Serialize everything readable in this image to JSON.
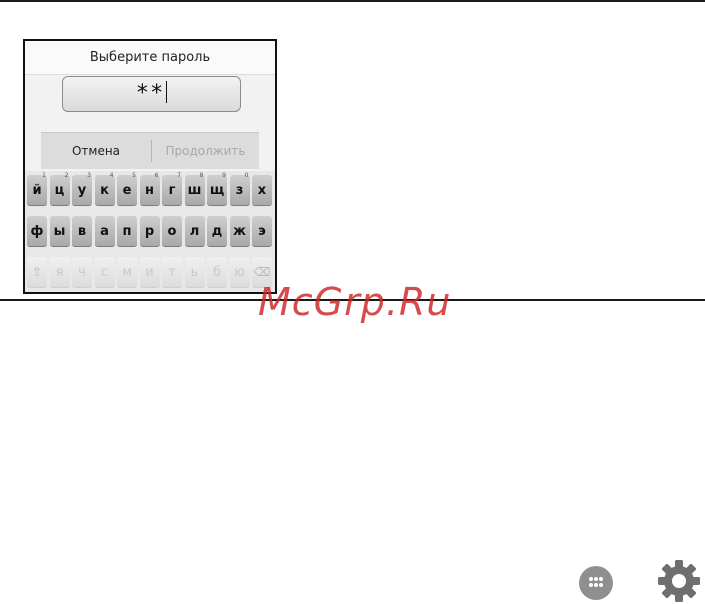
{
  "dialog": {
    "title": "Выберите пароль",
    "password_value": "**",
    "cancel_label": "Отмена",
    "continue_label": "Продолжить"
  },
  "keyboard": {
    "row1": [
      {
        "key": "й",
        "hint": "1"
      },
      {
        "key": "ц",
        "hint": "2"
      },
      {
        "key": "у",
        "hint": "3"
      },
      {
        "key": "к",
        "hint": "4"
      },
      {
        "key": "е",
        "hint": "5"
      },
      {
        "key": "н",
        "hint": "6"
      },
      {
        "key": "г",
        "hint": "7"
      },
      {
        "key": "ш",
        "hint": "8"
      },
      {
        "key": "щ",
        "hint": "9"
      },
      {
        "key": "з",
        "hint": "0"
      },
      {
        "key": "х",
        "hint": ""
      }
    ],
    "row2": [
      "ф",
      "ы",
      "в",
      "а",
      "п",
      "р",
      "о",
      "л",
      "д",
      "ж",
      "э"
    ],
    "row3": [
      "⇧",
      "я",
      "ч",
      "с",
      "м",
      "и",
      "т",
      "ь",
      "б",
      "ю",
      "⌫"
    ]
  },
  "watermark": "McGrp.Ru",
  "icons": {
    "apps": "apps-grid-icon",
    "settings": "gear-icon"
  },
  "colors": {
    "watermark": "#cd2323",
    "key_active": "#a9a9a9",
    "key_disabled": "#dcdcdc"
  }
}
